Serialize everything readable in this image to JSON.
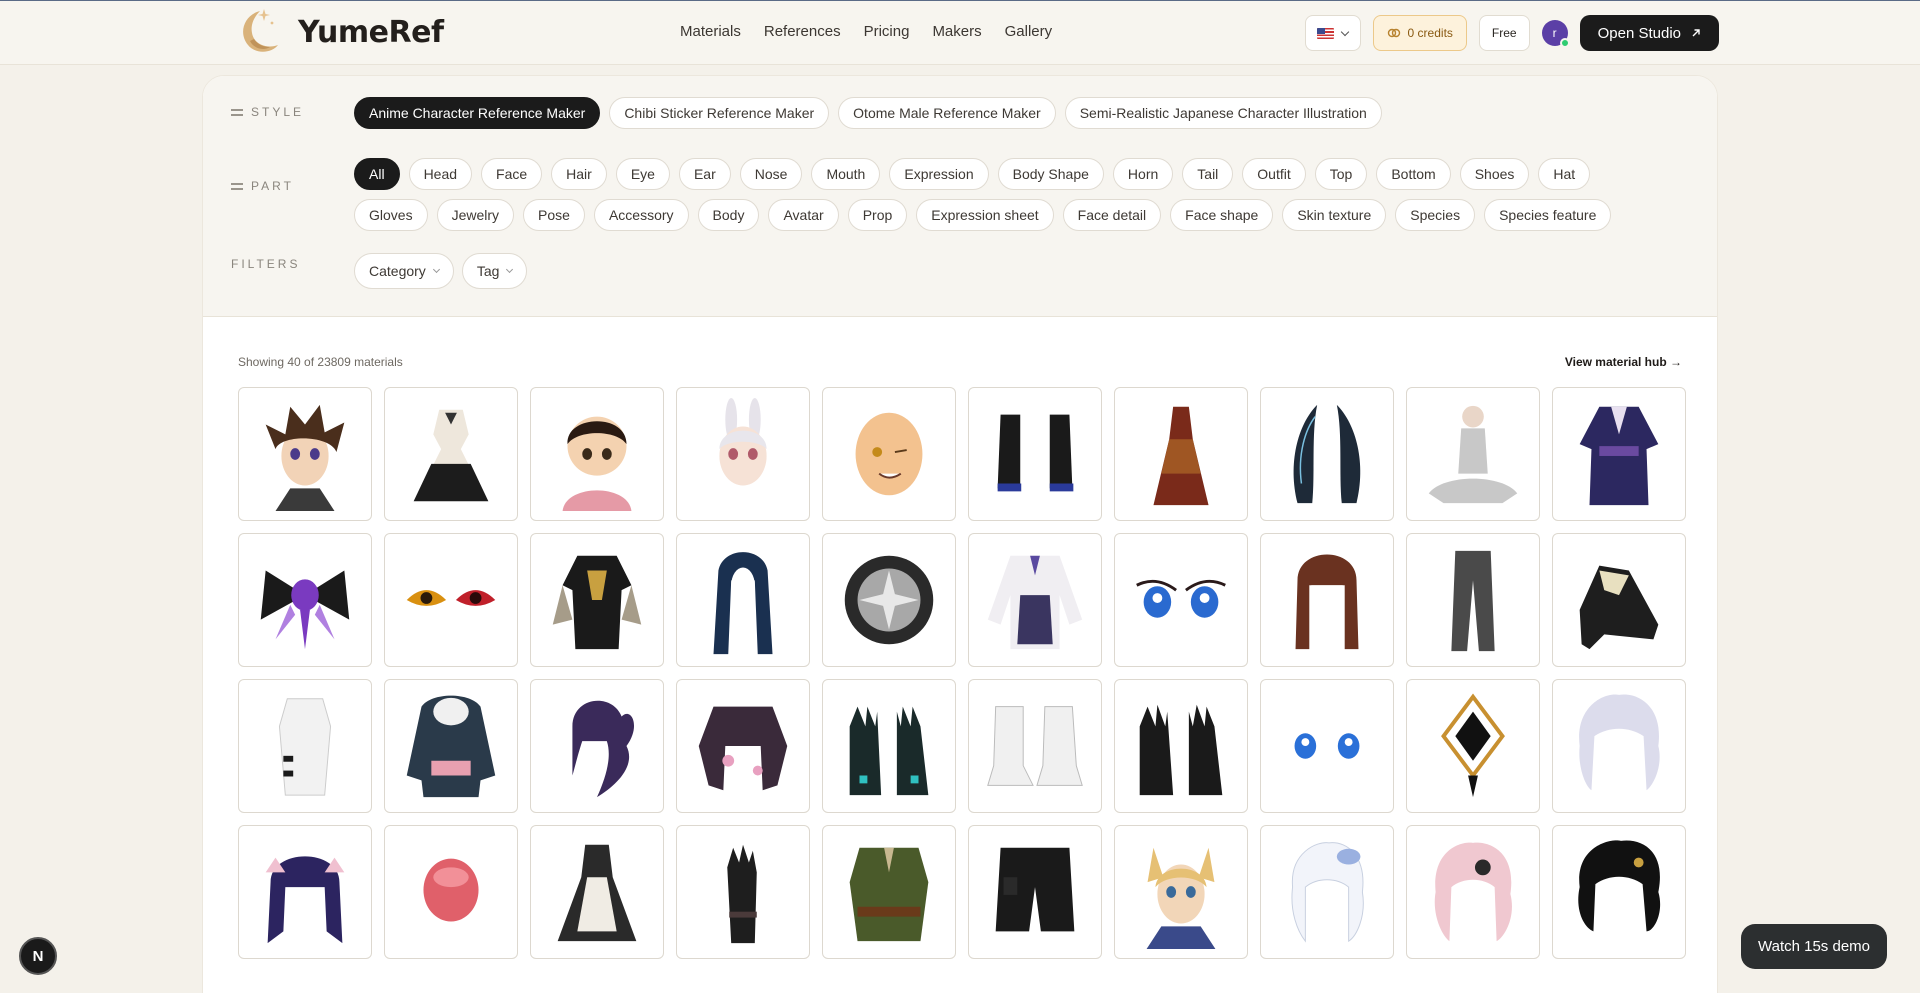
{
  "brand": {
    "name": "YumeRef"
  },
  "nav": [
    {
      "label": "Materials"
    },
    {
      "label": "References"
    },
    {
      "label": "Pricing"
    },
    {
      "label": "Makers"
    },
    {
      "label": "Gallery"
    }
  ],
  "header": {
    "credits_label": "0 credits",
    "plan_label": "Free",
    "avatar_letter": "r",
    "studio_label": "Open Studio",
    "studio_icon": "arrow-up-right",
    "locale_icon": "us-flag"
  },
  "filters": {
    "style_label": "STYLE",
    "styles": [
      {
        "label": "Anime Character Reference Maker",
        "active": true
      },
      {
        "label": "Chibi Sticker Reference Maker"
      },
      {
        "label": "Otome Male Reference Maker"
      },
      {
        "label": "Semi-Realistic Japanese Character Illustration"
      }
    ],
    "part_label": "PART",
    "parts": [
      "All",
      "Head",
      "Face",
      "Hair",
      "Eye",
      "Ear",
      "Nose",
      "Mouth",
      "Expression",
      "Body Shape",
      "Horn",
      "Tail",
      "Outfit",
      "Top",
      "Bottom",
      "Shoes",
      "Hat",
      "Gloves",
      "Jewelry",
      "Pose",
      "Accessory",
      "Body",
      "Avatar",
      "Prop",
      "Expression sheet",
      "Face detail",
      "Face shape",
      "Skin texture",
      "Species",
      "Species feature"
    ],
    "active_part": "All",
    "filters_label": "FILTERS",
    "dropdowns": [
      {
        "label": "Category"
      },
      {
        "label": "Tag"
      }
    ]
  },
  "results": {
    "showing_text": "Showing 40 of 23809 materials",
    "hub_link": "View material hub →"
  },
  "materials": [
    {
      "kind": "portrait-brown-hair"
    },
    {
      "kind": "gothic-dress"
    },
    {
      "kind": "chibi-boy-hoodie"
    },
    {
      "kind": "bunny-ear-boy"
    },
    {
      "kind": "bald-face-wink"
    },
    {
      "kind": "black-heels"
    },
    {
      "kind": "red-gown"
    },
    {
      "kind": "dark-horns"
    },
    {
      "kind": "meditating-mannequin"
    },
    {
      "kind": "purple-kimono"
    },
    {
      "kind": "purple-bow-brooch"
    },
    {
      "kind": "anime-eyes-gold-red"
    },
    {
      "kind": "black-gold-top"
    },
    {
      "kind": "long-blue-hair"
    },
    {
      "kind": "silver-ring"
    },
    {
      "kind": "white-corset-blouse"
    },
    {
      "kind": "blue-eyes"
    },
    {
      "kind": "brown-bob-hair"
    },
    {
      "kind": "grey-trousers"
    },
    {
      "kind": "black-frill-shoe"
    },
    {
      "kind": "white-qipao-top"
    },
    {
      "kind": "penguin-hoodie"
    },
    {
      "kind": "purple-ponytail"
    },
    {
      "kind": "floral-jacket"
    },
    {
      "kind": "teal-gloves"
    },
    {
      "kind": "white-boots"
    },
    {
      "kind": "black-gloves"
    },
    {
      "kind": "blue-eyes-small"
    },
    {
      "kind": "gold-pendant"
    },
    {
      "kind": "silver-hair"
    },
    {
      "kind": "purple-twin-hair"
    },
    {
      "kind": "red-egg"
    },
    {
      "kind": "maid-dress"
    },
    {
      "kind": "black-gauntlet"
    },
    {
      "kind": "green-vest"
    },
    {
      "kind": "black-cargo-shorts"
    },
    {
      "kind": "fox-ear-man"
    },
    {
      "kind": "white-lace-hair"
    },
    {
      "kind": "pink-hair"
    },
    {
      "kind": "black-curly-hair"
    }
  ],
  "footer": {
    "badge_letter": "N",
    "demo_label": "Watch 15s demo"
  }
}
